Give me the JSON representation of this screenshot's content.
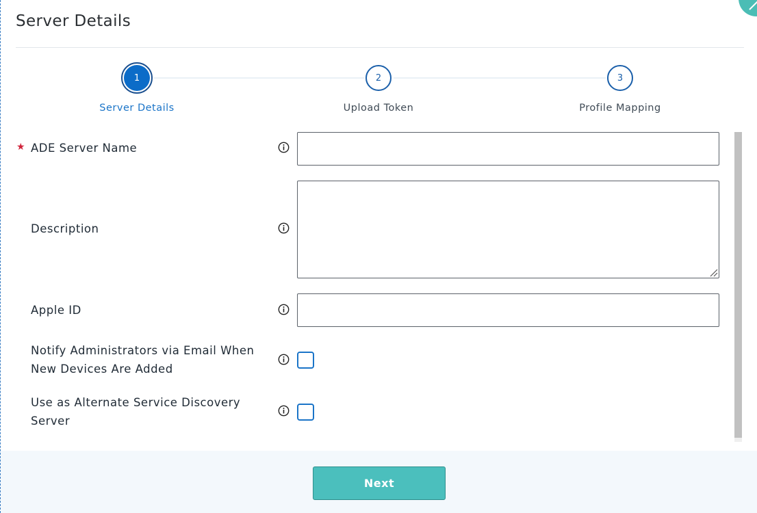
{
  "dialog": {
    "title": "Server Details"
  },
  "stepper": {
    "steps": [
      {
        "number": "1",
        "label": "Server Details",
        "state": "active"
      },
      {
        "number": "2",
        "label": "Upload Token",
        "state": "pending"
      },
      {
        "number": "3",
        "label": "Profile Mapping",
        "state": "pending"
      }
    ]
  },
  "form": {
    "server_name": {
      "label": "ADE Server Name",
      "required": true,
      "value": "",
      "info_icon": "info-icon"
    },
    "description": {
      "label": "Description",
      "value": "",
      "info_icon": "info-icon"
    },
    "apple_id": {
      "label": "Apple ID",
      "value": "",
      "info_icon": "info-icon"
    },
    "notify_admins": {
      "label": "Notify Administrators via Email When New Devices Are Added",
      "checked": false,
      "info_icon": "info-icon"
    },
    "alternate_discovery": {
      "label": "Use as Alternate Service Discovery Server",
      "checked": false,
      "info_icon": "info-icon"
    }
  },
  "footer": {
    "next_label": "Next"
  },
  "colors": {
    "accent": "#0c6cc8",
    "step_border": "#1a5faa",
    "required": "#d0243b",
    "next_button": "#4bbfbd",
    "footer_bg": "#f3f8fc"
  }
}
